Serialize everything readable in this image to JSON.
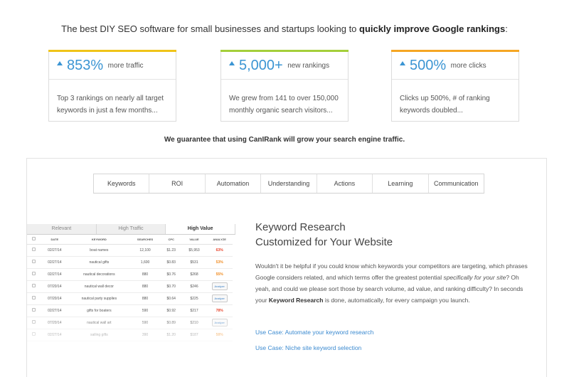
{
  "tagline": {
    "lead": "The best DIY SEO software for small businesses and startups looking to ",
    "strong": "quickly improve Google rankings",
    "tail": ":"
  },
  "stats": [
    {
      "number": "853%",
      "unit": "more traffic",
      "description": "Top 3 rankings on nearly all target keywords in just a few months...",
      "accent": "#f0c419"
    },
    {
      "number": "5,000+",
      "unit": "new rankings",
      "description": "We grew from 141 to over 150,000 monthly organic search visitors...",
      "accent": "#a4cf3a"
    },
    {
      "number": "500%",
      "unit": "more clicks",
      "description": "Clicks up 500%, # of ranking keywords doubled...",
      "accent": "#f5a623"
    }
  ],
  "guarantee": "We guarantee that using CanIRank will grow your search engine traffic.",
  "feature_tabs": [
    "Keywords",
    "ROI",
    "Automation",
    "Understanding",
    "Actions",
    "Learning",
    "Communication"
  ],
  "mini_table": {
    "tabs": [
      "Relevant",
      "High Traffic",
      "High Value"
    ],
    "columns": [
      "DATE",
      "KEYWORD",
      "SEARCHES",
      "CPC",
      "VALUE",
      "ANALYZE"
    ],
    "rows": [
      {
        "date": "02/27/14",
        "keyword": "boat names",
        "searches": "12,100",
        "cpc": "$1.23",
        "value": "$5,953",
        "analyze": "63%",
        "color": "#e8432a"
      },
      {
        "date": "02/27/14",
        "keyword": "nautical gifts",
        "searches": "1,600",
        "cpc": "$0.83",
        "value": "$531",
        "analyze": "53%",
        "color": "#f08a1e"
      },
      {
        "date": "02/27/14",
        "keyword": "nautical decorations",
        "searches": "880",
        "cpc": "$0.76",
        "value": "$268",
        "analyze": "55%",
        "color": "#f08a1e"
      },
      {
        "date": "07/20/14",
        "keyword": "nautical wall decor",
        "searches": "880",
        "cpc": "$0.70",
        "value": "$246",
        "analyze": "Analyze",
        "color": ""
      },
      {
        "date": "07/20/14",
        "keyword": "nautical party supplies",
        "searches": "880",
        "cpc": "$0.64",
        "value": "$225",
        "analyze": "Analyze",
        "color": ""
      },
      {
        "date": "02/27/14",
        "keyword": "gifts for boaters",
        "searches": "590",
        "cpc": "$0.92",
        "value": "$217",
        "analyze": "78%",
        "color": "#e8432a"
      },
      {
        "date": "07/20/14",
        "keyword": "nautical wall art",
        "searches": "590",
        "cpc": "$0.89",
        "value": "$210",
        "analyze": "Analyze",
        "color": ""
      },
      {
        "date": "02/27/14",
        "keyword": "sailing gifts",
        "searches": "390",
        "cpc": "$1.20",
        "value": "$187",
        "analyze": "58%",
        "color": "#f08a1e"
      }
    ]
  },
  "keyword_research": {
    "title_line1": "Keyword Research",
    "title_line2": "Customized for Your Website",
    "body_1": "Wouldn't it be helpful if you could know which keywords your competitors are targeting, which phrases Google considers related, and which terms offer the greatest potential ",
    "body_em": "specifically for your site",
    "body_2": "? Oh yeah, and could we please sort those by search volume, ad value, and ranking difficulty? In seconds your ",
    "body_strong": "Keyword Research",
    "body_3": " is done, automatically, for every campaign you launch.",
    "links": [
      "Use Case: Automate your keyword research",
      "Use Case: Niche site keyword selection"
    ]
  }
}
